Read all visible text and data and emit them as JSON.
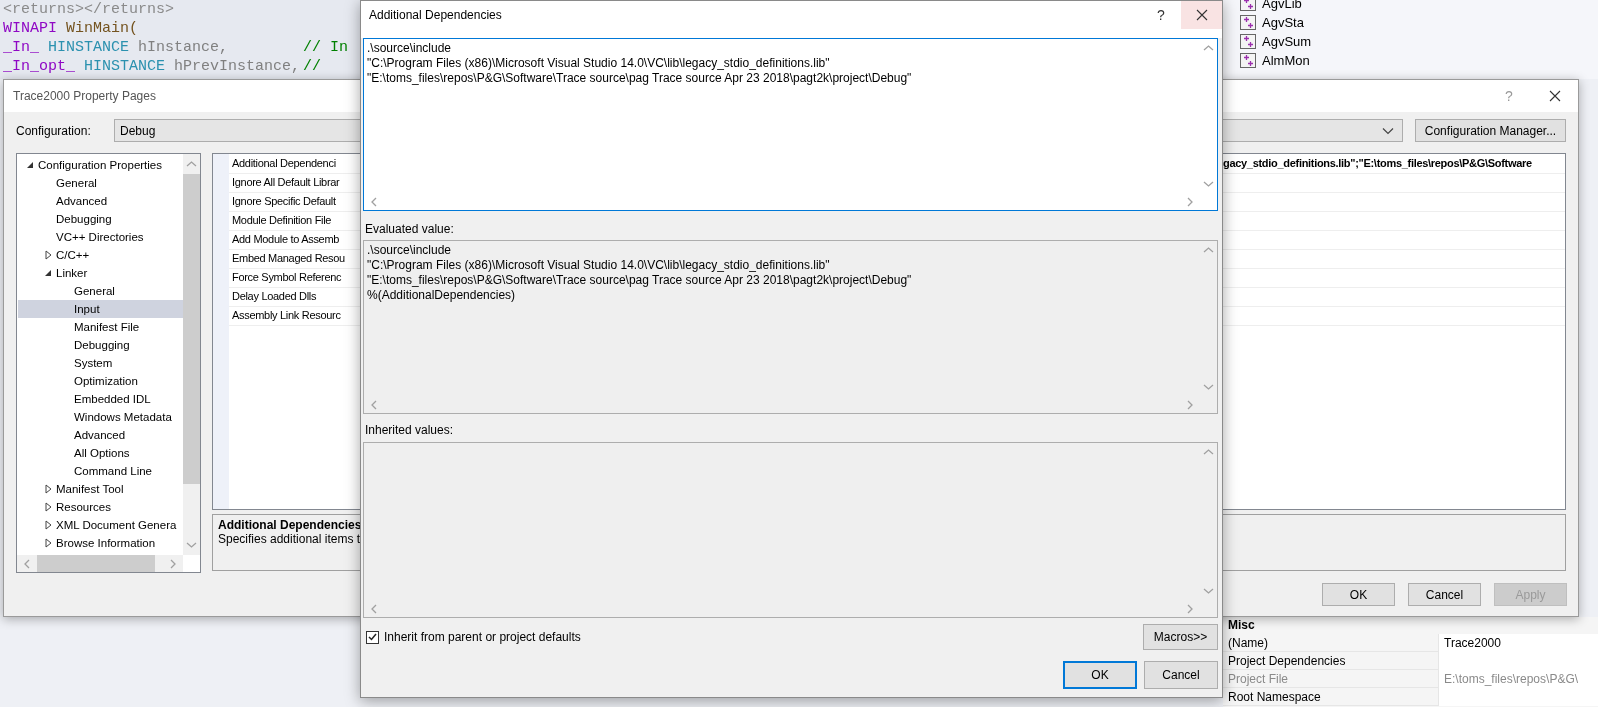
{
  "code_editor": {
    "lines": [
      {
        "tokens": [
          {
            "text": "<returns></returns>",
            "kind": "doc"
          }
        ]
      },
      {
        "tokens": [
          {
            "text": "WINAPI",
            "kind": "macro"
          },
          {
            "text": "WinMain(",
            "kind": "function"
          }
        ]
      },
      {
        "tokens": [
          {
            "text": "_In_",
            "kind": "macro"
          },
          {
            "text": "HINSTANCE",
            "kind": "type"
          },
          {
            "text": "hInstance,",
            "kind": "param"
          },
          {
            "text": "// In",
            "kind": "comment"
          }
        ]
      },
      {
        "tokens": [
          {
            "text": "_In_opt_",
            "kind": "macro"
          },
          {
            "text": "HINSTANCE",
            "kind": "type"
          },
          {
            "text": "hPrevInstance,",
            "kind": "param"
          },
          {
            "text": "//",
            "kind": "comment"
          }
        ]
      }
    ]
  },
  "solution_explorer": {
    "items": [
      {
        "label": "AgvLib"
      },
      {
        "label": "AgvSta"
      },
      {
        "label": "AgvSum"
      },
      {
        "label": "AlmMon"
      }
    ]
  },
  "property_pages": {
    "title": "Trace2000 Property Pages",
    "help": "?",
    "configuration_label": "Configuration:",
    "configuration": "Debug",
    "configuration_manager": "Configuration Manager...",
    "tree": [
      {
        "label": "Configuration Properties",
        "kind": "folder",
        "expanded": true,
        "selected": false,
        "children": [
          {
            "label": "General",
            "kind": "page",
            "selected": false
          },
          {
            "label": "Advanced",
            "kind": "page",
            "selected": false
          },
          {
            "label": "Debugging",
            "kind": "page",
            "selected": false
          },
          {
            "label": "VC++ Directories",
            "kind": "page",
            "selected": false
          },
          {
            "label": "C/C++",
            "kind": "folder",
            "expanded": false,
            "selected": false
          },
          {
            "label": "Linker",
            "kind": "folder",
            "expanded": true,
            "selected": false,
            "children": [
              {
                "label": "General",
                "kind": "page",
                "selected": false
              },
              {
                "label": "Input",
                "kind": "page",
                "selected": true
              },
              {
                "label": "Manifest File",
                "kind": "page",
                "selected": false
              },
              {
                "label": "Debugging",
                "kind": "page",
                "selected": false
              },
              {
                "label": "System",
                "kind": "page",
                "selected": false
              },
              {
                "label": "Optimization",
                "kind": "page",
                "selected": false
              },
              {
                "label": "Embedded IDL",
                "kind": "page",
                "selected": false
              },
              {
                "label": "Windows Metadata",
                "kind": "page",
                "selected": false
              },
              {
                "label": "Advanced",
                "kind": "page",
                "selected": false
              },
              {
                "label": "All Options",
                "kind": "page",
                "selected": false
              },
              {
                "label": "Command Line",
                "kind": "page",
                "selected": false
              }
            ]
          },
          {
            "label": "Manifest Tool",
            "kind": "folder",
            "expanded": false,
            "selected": false
          },
          {
            "label": "Resources",
            "kind": "folder",
            "expanded": false,
            "selected": false
          },
          {
            "label": "XML Document Genera",
            "kind": "folder",
            "expanded": false,
            "selected": false
          },
          {
            "label": "Browse Information",
            "kind": "folder",
            "expanded": false,
            "selected": false
          }
        ]
      }
    ],
    "properties": [
      {
        "name": "Additional Dependenci",
        "value": "gacy_stdio_definitions.lib\";\"E:\\toms_files\\repos\\P&G\\Software"
      },
      {
        "name": "Ignore All Default Librar"
      },
      {
        "name": "Ignore Specific Default"
      },
      {
        "name": "Module Definition File"
      },
      {
        "name": "Add Module to Assemb"
      },
      {
        "name": "Embed Managed Resou"
      },
      {
        "name": "Force Symbol Referenc"
      },
      {
        "name": "Delay Loaded Dlls"
      },
      {
        "name": "Assembly Link Resourc"
      }
    ],
    "description": {
      "title": "Additional Dependencies",
      "text": "Specifies additional items t"
    },
    "buttons": [
      {
        "label": "OK",
        "disabled": false
      },
      {
        "label": "Cancel",
        "disabled": false
      },
      {
        "label": "Apply",
        "disabled": true
      }
    ]
  },
  "dependencies_dialog": {
    "title": "Additional Dependencies",
    "help": "?",
    "value_lines": [
      ".\\source\\include",
      "\"C:\\Program Files (x86)\\Microsoft Visual Studio 14.0\\VC\\lib\\legacy_stdio_definitions.lib\"",
      "\"E:\\toms_files\\repos\\P&G\\Software\\Trace source\\pag Trace source Apr 23 2018\\pagt2k\\project\\Debug\""
    ],
    "evaluated_label": "Evaluated value:",
    "evaluated_lines": [
      ".\\source\\include",
      "\"C:\\Program Files (x86)\\Microsoft Visual Studio 14.0\\VC\\lib\\legacy_stdio_definitions.lib\"",
      "\"E:\\toms_files\\repos\\P&G\\Software\\Trace source\\pag Trace source Apr 23 2018\\pagt2k\\project\\Debug\"",
      "%(AdditionalDependencies)"
    ],
    "inherited_label": "Inherited values:",
    "inherit": {
      "label": "Inherit from parent or project defaults",
      "checked": true
    },
    "macros_button": "Macros>>",
    "buttons": [
      {
        "label": "OK",
        "default": true
      },
      {
        "label": "Cancel",
        "default": false
      }
    ]
  },
  "properties_panel": {
    "category": "Misc",
    "rows": [
      {
        "name": "(Name)",
        "value": "Trace2000",
        "disabled": false
      },
      {
        "name": "Project Dependencies",
        "disabled": false
      },
      {
        "name": "Project File",
        "value": "E:\\toms_files\\repos\\P&G\\",
        "disabled": true
      },
      {
        "name": "Root Namespace",
        "disabled": false
      }
    ]
  }
}
